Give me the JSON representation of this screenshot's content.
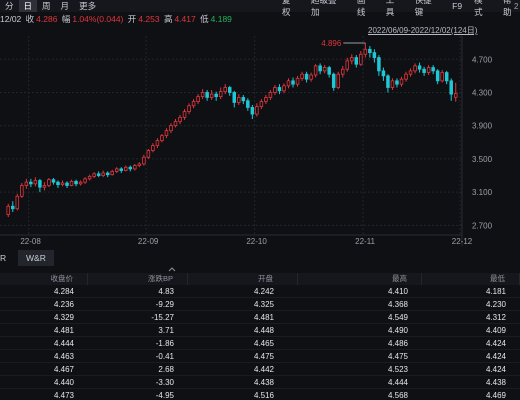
{
  "toolbar": {
    "periods": [
      "分",
      "日",
      "周",
      "月",
      "更多"
    ],
    "active_period": 1,
    "tools": [
      "复权",
      "超级叠加",
      "画线",
      "工具",
      "快捷键",
      "F9",
      "模式",
      "帮助"
    ],
    "side_digit": "2"
  },
  "quote": {
    "date": "12/02",
    "close_label": "收",
    "close": "4.286",
    "change_label": "幅",
    "change": "1.04%(0.044)",
    "open_label": "开",
    "open": "4.253",
    "high_label": "高",
    "high": "4.417",
    "low_label": "低",
    "low": "4.189"
  },
  "range_label": "2022/06/09-2022/12/02(124日)",
  "chart_data": {
    "type": "candlestick",
    "y_ticks": [
      "4.700",
      "4.300",
      "3.900",
      "3.500",
      "3.100",
      "2.700"
    ],
    "y_tick_values": [
      4.7,
      4.3,
      3.9,
      3.5,
      3.1,
      2.7
    ],
    "x_ticks": [
      "22-08",
      "22-09",
      "22-10",
      "22-11",
      "22-12"
    ],
    "ylim": [
      2.62,
      4.98
    ],
    "max_annotation": "4.896",
    "max_value": 4.896,
    "up_color": "#e0363c",
    "down_color": "#1ec8d4",
    "month_boundaries": [
      5,
      31,
      55,
      79,
      103
    ],
    "candles": [
      [
        2.83,
        2.93,
        2.8,
        2.96
      ],
      [
        2.93,
        2.9,
        2.86,
        2.99
      ],
      [
        2.9,
        3.05,
        2.88,
        3.08
      ],
      [
        3.05,
        3.18,
        3.03,
        3.21
      ],
      [
        3.18,
        3.22,
        3.14,
        3.26
      ],
      [
        3.22,
        3.2,
        3.16,
        3.26
      ],
      [
        3.2,
        3.24,
        3.17,
        3.28
      ],
      [
        3.24,
        3.16,
        3.1,
        3.26
      ],
      [
        3.16,
        3.18,
        3.12,
        3.22
      ],
      [
        3.18,
        3.25,
        3.16,
        3.27
      ],
      [
        3.25,
        3.22,
        3.19,
        3.27
      ],
      [
        3.22,
        3.19,
        3.15,
        3.24
      ],
      [
        3.19,
        3.21,
        3.17,
        3.24
      ],
      [
        3.21,
        3.18,
        3.15,
        3.23
      ],
      [
        3.18,
        3.23,
        3.17,
        3.25
      ],
      [
        3.23,
        3.2,
        3.17,
        3.25
      ],
      [
        3.2,
        3.22,
        3.18,
        3.24
      ],
      [
        3.22,
        3.26,
        3.2,
        3.28
      ],
      [
        3.26,
        3.29,
        3.24,
        3.31
      ],
      [
        3.29,
        3.32,
        3.27,
        3.34
      ],
      [
        3.32,
        3.3,
        3.28,
        3.35
      ],
      [
        3.3,
        3.33,
        3.28,
        3.36
      ],
      [
        3.33,
        3.31,
        3.28,
        3.35
      ],
      [
        3.31,
        3.35,
        3.3,
        3.37
      ],
      [
        3.35,
        3.38,
        3.33,
        3.4
      ],
      [
        3.38,
        3.36,
        3.33,
        3.4
      ],
      [
        3.36,
        3.4,
        3.35,
        3.42
      ],
      [
        3.4,
        3.38,
        3.35,
        3.42
      ],
      [
        3.38,
        3.42,
        3.36,
        3.44
      ],
      [
        3.42,
        3.44,
        3.4,
        3.46
      ],
      [
        3.44,
        3.52,
        3.42,
        3.55
      ],
      [
        3.52,
        3.6,
        3.5,
        3.62
      ],
      [
        3.6,
        3.66,
        3.58,
        3.69
      ],
      [
        3.66,
        3.72,
        3.63,
        3.75
      ],
      [
        3.72,
        3.78,
        3.7,
        3.8
      ],
      [
        3.78,
        3.84,
        3.75,
        3.87
      ],
      [
        3.84,
        3.9,
        3.81,
        3.93
      ],
      [
        3.9,
        3.95,
        3.88,
        3.98
      ],
      [
        3.95,
        4.0,
        3.92,
        4.03
      ],
      [
        4.0,
        4.07,
        3.97,
        4.1
      ],
      [
        4.07,
        4.14,
        4.04,
        4.17
      ],
      [
        4.14,
        4.19,
        4.11,
        4.22
      ],
      [
        4.19,
        4.25,
        4.16,
        4.28
      ],
      [
        4.25,
        4.3,
        4.22,
        4.34
      ],
      [
        4.3,
        4.24,
        4.2,
        4.33
      ],
      [
        4.24,
        4.28,
        4.21,
        4.33
      ],
      [
        4.28,
        4.25,
        4.2,
        4.31
      ],
      [
        4.25,
        4.31,
        4.22,
        4.36
      ],
      [
        4.31,
        4.36,
        4.28,
        4.4
      ],
      [
        4.36,
        4.3,
        4.26,
        4.38
      ],
      [
        4.3,
        4.18,
        4.12,
        4.32
      ],
      [
        4.18,
        4.24,
        4.15,
        4.28
      ],
      [
        4.24,
        4.2,
        4.16,
        4.27
      ],
      [
        4.2,
        4.12,
        4.08,
        4.23
      ],
      [
        4.12,
        4.04,
        3.98,
        4.15
      ],
      [
        4.04,
        4.13,
        4.01,
        4.17
      ],
      [
        4.13,
        4.19,
        4.1,
        4.22
      ],
      [
        4.19,
        4.24,
        4.16,
        4.27
      ],
      [
        4.24,
        4.3,
        4.21,
        4.33
      ],
      [
        4.3,
        4.36,
        4.27,
        4.39
      ],
      [
        4.36,
        4.32,
        4.28,
        4.4
      ],
      [
        4.32,
        4.38,
        4.29,
        4.41
      ],
      [
        4.38,
        4.44,
        4.35,
        4.47
      ],
      [
        4.44,
        4.4,
        4.36,
        4.48
      ],
      [
        4.4,
        4.47,
        4.37,
        4.5
      ],
      [
        4.47,
        4.52,
        4.44,
        4.55
      ],
      [
        4.52,
        4.46,
        4.42,
        4.55
      ],
      [
        4.46,
        4.51,
        4.43,
        4.54
      ],
      [
        4.51,
        4.62,
        4.48,
        4.64
      ],
      [
        4.62,
        4.56,
        4.52,
        4.65
      ],
      [
        4.56,
        4.6,
        4.53,
        4.63
      ],
      [
        4.6,
        4.52,
        4.48,
        4.62
      ],
      [
        4.52,
        4.36,
        4.32,
        4.54
      ],
      [
        4.36,
        4.52,
        4.34,
        4.55
      ],
      [
        4.52,
        4.58,
        4.48,
        4.62
      ],
      [
        4.58,
        4.68,
        4.55,
        4.72
      ],
      [
        4.68,
        4.72,
        4.64,
        4.76
      ],
      [
        4.72,
        4.64,
        4.6,
        4.75
      ],
      [
        4.64,
        4.76,
        4.62,
        4.8
      ],
      [
        4.76,
        4.82,
        4.72,
        4.896
      ],
      [
        4.82,
        4.78,
        4.72,
        4.86
      ],
      [
        4.78,
        4.72,
        4.66,
        4.82
      ],
      [
        4.72,
        4.56,
        4.5,
        4.75
      ],
      [
        4.56,
        4.5,
        4.44,
        4.6
      ],
      [
        4.5,
        4.36,
        4.3,
        4.52
      ],
      [
        4.36,
        4.44,
        4.33,
        4.47
      ],
      [
        4.44,
        4.4,
        4.36,
        4.47
      ],
      [
        4.4,
        4.46,
        4.37,
        4.49
      ],
      [
        4.46,
        4.52,
        4.43,
        4.55
      ],
      [
        4.52,
        4.56,
        4.49,
        4.59
      ],
      [
        4.56,
        4.62,
        4.53,
        4.65
      ],
      [
        4.62,
        4.58,
        4.54,
        4.66
      ],
      [
        4.58,
        4.54,
        4.5,
        4.61
      ],
      [
        4.54,
        4.6,
        4.51,
        4.63
      ],
      [
        4.6,
        4.56,
        4.52,
        4.63
      ],
      [
        4.56,
        4.44,
        4.4,
        4.58
      ],
      [
        4.44,
        4.54,
        4.42,
        4.57
      ],
      [
        4.54,
        4.44,
        4.4,
        4.56
      ],
      [
        4.44,
        4.28,
        4.2,
        4.47
      ],
      [
        4.242,
        4.286,
        4.189,
        4.417
      ]
    ]
  },
  "tabs": [
    "R",
    "W&R",
    "",
    "",
    ""
  ],
  "table": {
    "headers": [
      "收盘价",
      "涨跌BP",
      "开盘",
      "最高",
      "最低"
    ],
    "rows": [
      [
        "4.284",
        "4.83",
        "4.242",
        "4.410",
        "4.181"
      ],
      [
        "4.236",
        "-9.29",
        "4.325",
        "4.368",
        "4.230"
      ],
      [
        "4.329",
        "-15.27",
        "4.481",
        "4.549",
        "4.312"
      ],
      [
        "4.481",
        "3.71",
        "4.448",
        "4.490",
        "4.409"
      ],
      [
        "4.444",
        "-1.86",
        "4.465",
        "4.486",
        "4.424"
      ],
      [
        "4.463",
        "-0.41",
        "4.475",
        "4.475",
        "4.424"
      ],
      [
        "4.467",
        "2.68",
        "4.442",
        "4.523",
        "4.424"
      ],
      [
        "4.440",
        "-3.30",
        "4.438",
        "4.444",
        "4.438"
      ],
      [
        "4.473",
        "-4.95",
        "4.516",
        "4.568",
        "4.469"
      ]
    ]
  }
}
